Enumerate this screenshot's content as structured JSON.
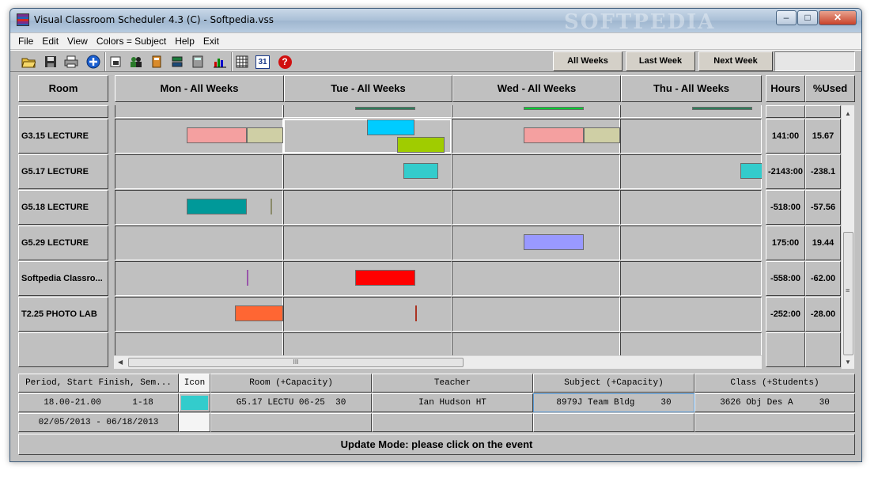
{
  "window": {
    "title": "Visual Classroom Scheduler 4.3 (C) - Softpedia.vss",
    "watermark": "SOFTPEDIA"
  },
  "window_controls": {
    "minimize": "–",
    "maximize": "□",
    "close": "✕"
  },
  "menu": [
    "File",
    "Edit",
    "View",
    "Colors = Subject",
    "Help",
    "Exit"
  ],
  "toolbar": {
    "icons": [
      "open-folder-icon",
      "save-icon",
      "print-icon",
      "add-icon",
      "new-window-icon",
      "people-icon",
      "book-icon",
      "sorter-icon",
      "calculator-icon",
      "bar-chart-icon",
      "grid-icon",
      "calendar-icon",
      "help-icon"
    ],
    "calendar_label": "31",
    "help_label": "?",
    "all_weeks": "All Weeks",
    "last_week": "Last Week",
    "next_week": "Next Week"
  },
  "grid": {
    "room_header": "Room",
    "day_headers": [
      "Mon - All Weeks",
      "Tue - All Weeks",
      "Wed - All Weeks",
      "Thu - All Weeks"
    ],
    "hours_header": "Hours",
    "used_header": "%Used",
    "rows": [
      {
        "room": "G3.15 LECTURE",
        "hours": "141:00",
        "used": "15.67"
      },
      {
        "room": "G5.17 LECTURE",
        "hours": "-2143:00",
        "used": "-238.1"
      },
      {
        "room": "G5.18 LECTURE",
        "hours": "-518:00",
        "used": "-57.56"
      },
      {
        "room": "G5.29 LECTURE",
        "hours": "175:00",
        "used": "19.44"
      },
      {
        "room": "Softpedia Classro...",
        "hours": "-558:00",
        "used": "-62.00"
      },
      {
        "room": "T2.25 PHOTO LAB",
        "hours": "-252:00",
        "used": "-28.00"
      }
    ],
    "event_colors": {
      "pink": "#f4a0a0",
      "khaki": "#cfcfa5",
      "cyan": "#00ccff",
      "lime": "#a0cc00",
      "teal_light": "#33cccc",
      "teal_dark": "#009999",
      "lavender": "#9999ff",
      "red": "#ff0000",
      "orange": "#ff6633",
      "dark_green": "#2e7d5b",
      "green": "#00cc33"
    }
  },
  "scrollbar": {
    "h_grip": "III",
    "v_grip": "≡",
    "up": "▲",
    "down": "▼",
    "left": "◀",
    "right": "▶"
  },
  "detail": {
    "headers": {
      "period": "Period, Start Finish, Sem...",
      "icon": "Icon",
      "room": "Room (+Capacity)",
      "teacher": "Teacher",
      "subject": "Subject (+Capacity)",
      "class": "Class (+Students)"
    },
    "row1": {
      "period": "18.00-21.00      1-18",
      "icon_color": "#33cccc",
      "room": "G5.17 LECTU 06-25  30",
      "teacher": "Ian Hudson HT",
      "subject": "8979J Team Bldg     30",
      "class": "3626 Obj Des A     30"
    },
    "row2": {
      "dates": "02/05/2013 - 06/18/2013"
    }
  },
  "status": "Update Mode: please click on the event"
}
